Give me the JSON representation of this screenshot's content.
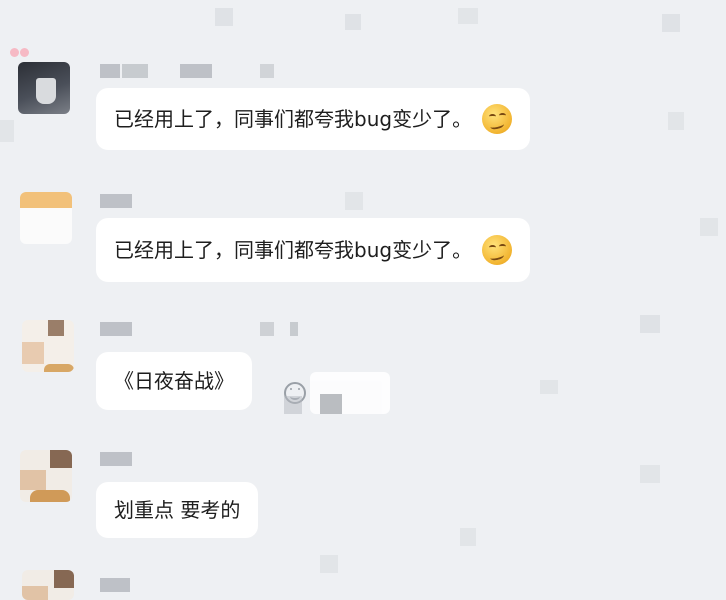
{
  "messages": [
    {
      "text": "已经用上了，同事们都夸我bug变少了。",
      "emoji": "smirk-emoji"
    },
    {
      "text": "已经用上了，同事们都夸我bug变少了。",
      "emoji": "smirk-emoji"
    },
    {
      "text": "《日夜奋战》",
      "emoji": ""
    },
    {
      "text": "划重点 要考的",
      "emoji": ""
    }
  ],
  "icons": {
    "reaction": "smile-face-icon"
  },
  "colors": {
    "background": "#eef0f3",
    "bubble": "#ffffff",
    "text": "#1e1e1e",
    "emoji": "#f2b430"
  }
}
